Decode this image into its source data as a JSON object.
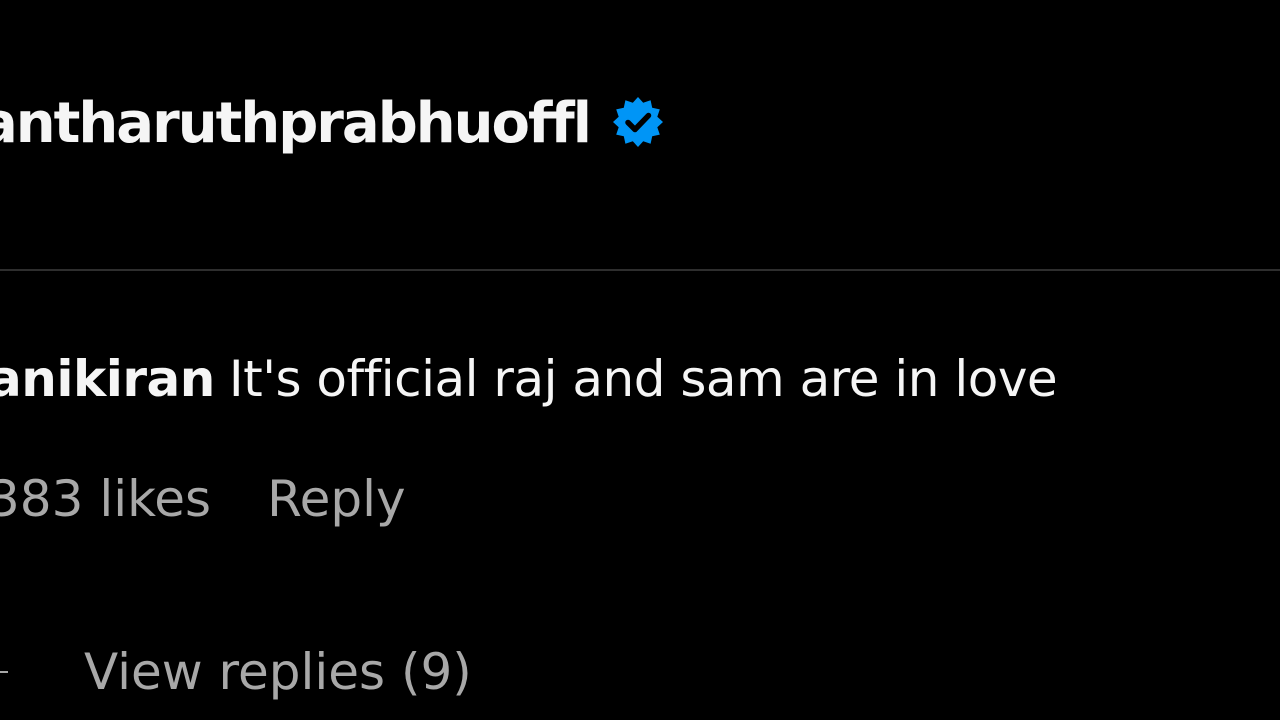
{
  "post": {
    "username": "antharuthprabhuoffl",
    "verified_icon": "verified-badge-icon",
    "verified_color": "#0095f6"
  },
  "comment": {
    "username": "anikiran",
    "text": "It's official raj and sam are in love",
    "likes": "383 likes",
    "reply_label": "Reply",
    "view_replies_label": "View replies (9)"
  },
  "colors": {
    "background": "#000000",
    "primary_text": "#f5f5f5",
    "secondary_text": "#a8a8a8",
    "divider": "#2e2e2e"
  }
}
